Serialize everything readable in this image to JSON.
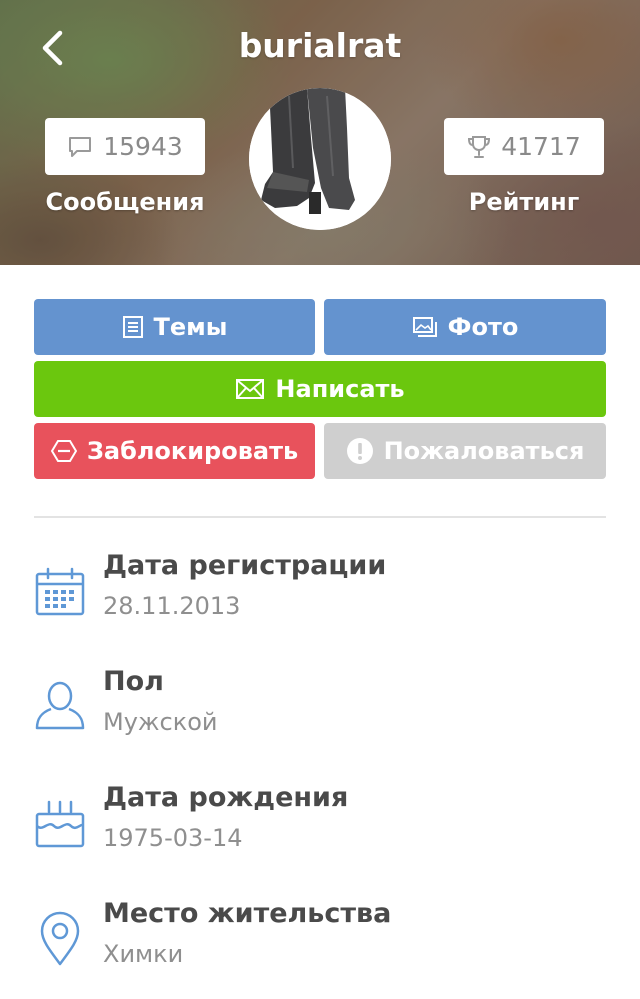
{
  "header": {
    "username": "burialrat",
    "messages_count": "15943",
    "messages_label": "Сообщения",
    "rating_value": "41717",
    "rating_label": "Рейтинг"
  },
  "buttons": {
    "topics": "Темы",
    "photo": "Фото",
    "write": "Написать",
    "block": "Заблокировать",
    "report": "Пожаловаться"
  },
  "info": [
    {
      "title": "Дата регистрации",
      "value": "28.11.2013",
      "icon": "calendar-icon"
    },
    {
      "title": "Пол",
      "value": "Мужской",
      "icon": "person-icon"
    },
    {
      "title": "Дата рождения",
      "value": "1975-03-14",
      "icon": "cake-icon"
    },
    {
      "title": "Место жительства",
      "value": "Химки",
      "icon": "location-pin-icon"
    }
  ],
  "colors": {
    "blue_button": "#6493cf",
    "green_button": "#6bc70e",
    "red_button": "#e8525c",
    "gray_button": "#cfcfcf",
    "icon_blue": "#5f98d6"
  }
}
